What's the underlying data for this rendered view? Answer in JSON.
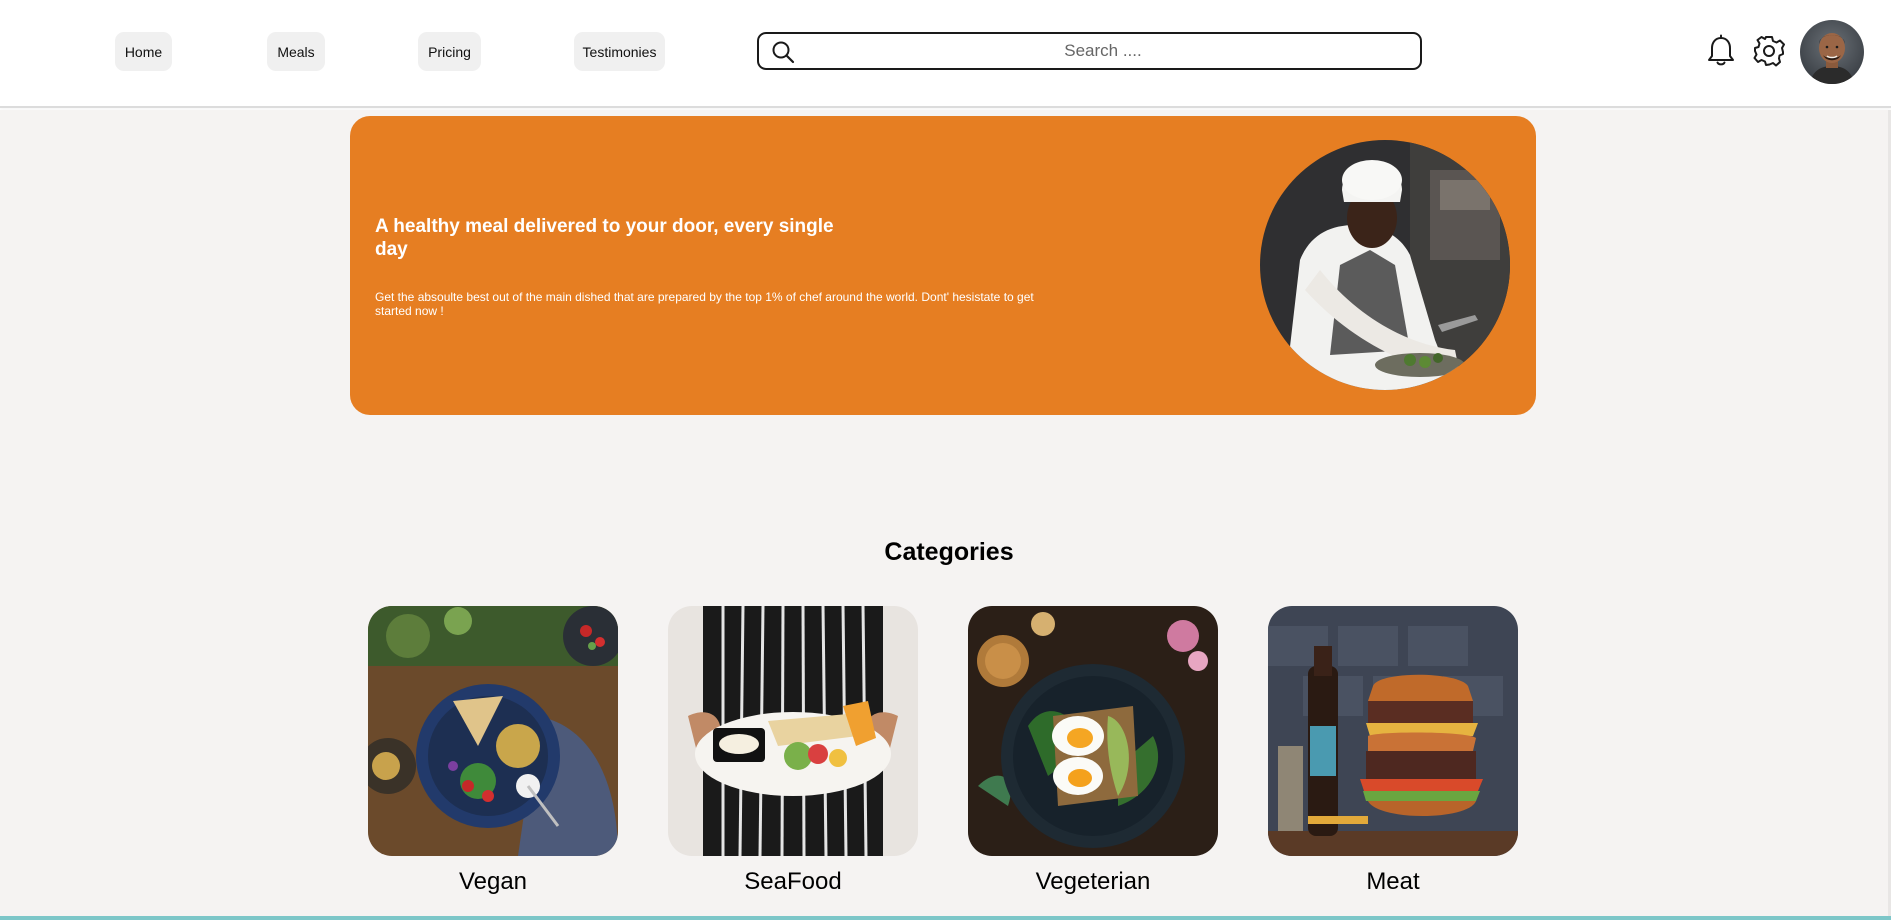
{
  "nav": {
    "items": [
      {
        "label": "Home"
      },
      {
        "label": "Meals"
      },
      {
        "label": "Pricing"
      },
      {
        "label": "Testimonies"
      }
    ],
    "search": {
      "placeholder": "Search ...."
    },
    "icons": [
      "bell-icon",
      "gear-icon",
      "user-avatar"
    ]
  },
  "hero": {
    "title": "A healthy meal delivered to your door, every single day",
    "text": "Get the absoulte best out of the main dished that are prepared by the top 1% of chef around the world. Dont' hesistate to get started now !",
    "background_color": "#e67e22"
  },
  "categories": {
    "title": "Categories",
    "items": [
      {
        "label": "Vegan"
      },
      {
        "label": "SeaFood"
      },
      {
        "label": "Vegeterian"
      },
      {
        "label": "Meat"
      }
    ]
  }
}
